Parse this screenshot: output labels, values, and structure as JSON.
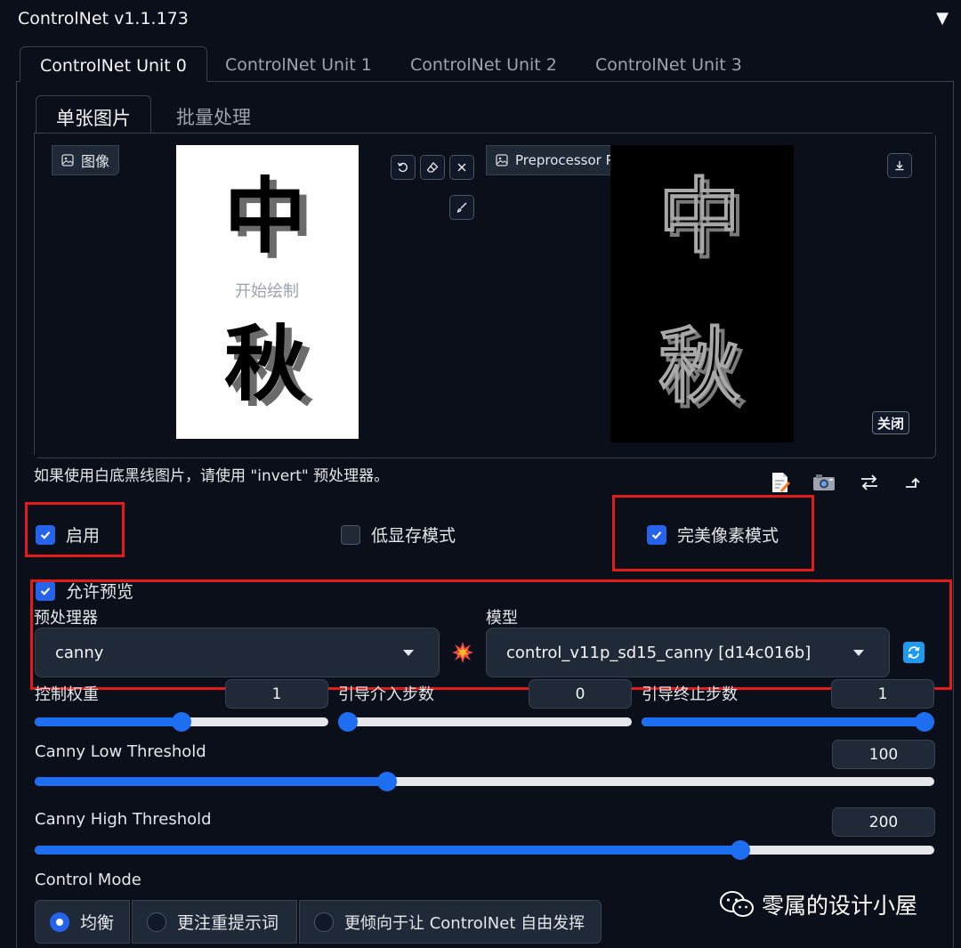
{
  "header": {
    "title": "ControlNet v1.1.173",
    "collapse_icon": "triangle-down-icon"
  },
  "unit_tabs": [
    {
      "label": "ControlNet Unit 0",
      "active": true
    },
    {
      "label": "ControlNet Unit 1",
      "active": false
    },
    {
      "label": "ControlNet Unit 2",
      "active": false
    },
    {
      "label": "ControlNet Unit 3",
      "active": false
    }
  ],
  "sub_tabs": [
    {
      "label": "单张图片",
      "active": true
    },
    {
      "label": "批量处理",
      "active": false
    }
  ],
  "input_image": {
    "label": "图像",
    "placeholder": "开始绘制",
    "char_top": "中",
    "char_bottom": "秋"
  },
  "preview_image": {
    "label": "Preprocessor Preview",
    "char_top": "中",
    "char_bottom": "秋",
    "close_label": "关闭"
  },
  "hint": "如果使用白底黑线图片，请使用 \"invert\" 预处理器。",
  "checkboxes": {
    "enable": {
      "label": "启用",
      "checked": true
    },
    "low_vram": {
      "label": "低显存模式",
      "checked": false
    },
    "pixel_perfect": {
      "label": "完美像素模式",
      "checked": true
    },
    "allow_preview": {
      "label": "允许预览",
      "checked": true
    }
  },
  "preprocessor": {
    "label": "预处理器",
    "value": "canny"
  },
  "model": {
    "label": "模型",
    "value": "control_v11p_sd15_canny [d14c016b]"
  },
  "sliders": {
    "weight": {
      "label": "控制权重",
      "value": "1",
      "fraction": 0.5
    },
    "start": {
      "label": "引导介入步数",
      "value": "0",
      "fraction": 0.0
    },
    "end": {
      "label": "引导终止步数",
      "value": "1",
      "fraction": 1.0
    },
    "canny_low": {
      "label": "Canny Low Threshold",
      "value": "100",
      "fraction": 0.392
    },
    "canny_high": {
      "label": "Canny High Threshold",
      "value": "200",
      "fraction": 0.784
    }
  },
  "control_mode": {
    "label": "Control Mode",
    "options": [
      {
        "label": "均衡",
        "selected": true
      },
      {
        "label": "更注重提示词",
        "selected": false
      },
      {
        "label": "更倾向于让 ControlNet 自由发挥",
        "selected": false
      }
    ]
  },
  "watermark": "零属的设计小屋",
  "colors": {
    "accent": "#2563eb",
    "highlight": "#e31b1b",
    "background": "#0b0f19"
  }
}
